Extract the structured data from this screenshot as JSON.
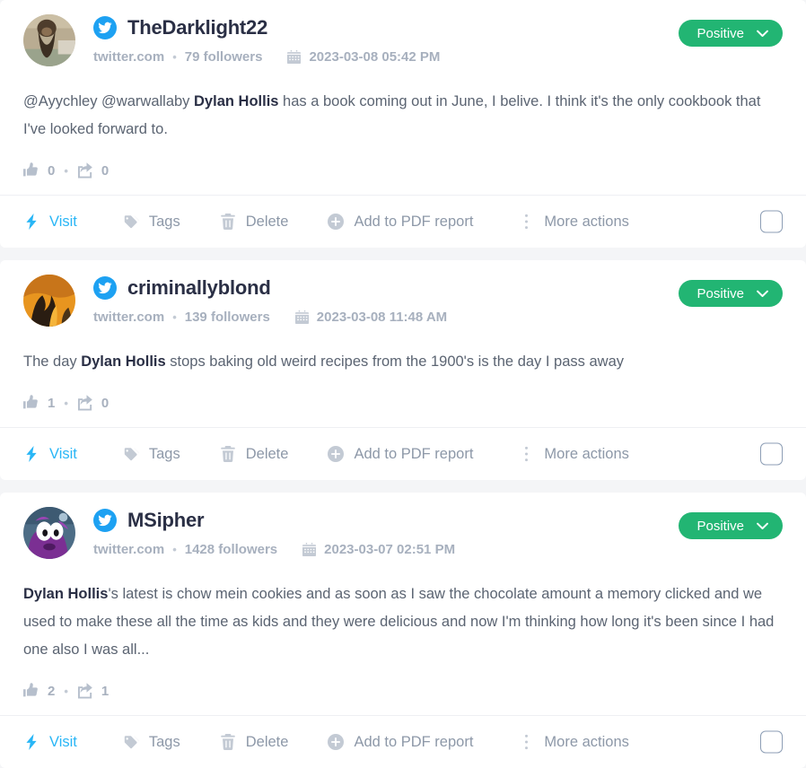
{
  "theme": {
    "page_background": "#f4f5f7",
    "card_background": "#ffffff",
    "accent_blue": "#29b6f6",
    "twitter_blue": "#1da1f2",
    "positive_green": "#22b573",
    "muted_text": "#a7b0be",
    "body_text": "#5b6472",
    "title_text": "#2a2f45"
  },
  "actions": {
    "visit": "Visit",
    "tags": "Tags",
    "delete": "Delete",
    "add_to_pdf": "Add to PDF report",
    "more": "More actions",
    "icons": {
      "visit": "lightning-bolt-icon",
      "tags": "tag-icon",
      "delete": "trash-icon",
      "add_to_pdf": "plus-circle-icon",
      "more": "vertical-dots-icon",
      "select": "checkbox-icon"
    }
  },
  "posts": [
    {
      "username": "TheDarklight22",
      "source": "twitter.com",
      "followers": "79 followers",
      "date": "2023-03-08 05:42 PM",
      "sentiment": "Positive",
      "avatar": "bearded-man-photo",
      "network_icon": "twitter-icon",
      "text_parts": [
        {
          "text": "@Ayychley @warwallaby ",
          "bold": false
        },
        {
          "text": "Dylan Hollis",
          "bold": true
        },
        {
          "text": " has a book coming out in June, I belive. I think it's the only cookbook that I've looked forward to.",
          "bold": false
        }
      ],
      "likes": "0",
      "shares": "0"
    },
    {
      "username": "criminallyblond",
      "source": "twitter.com",
      "followers": "139 followers",
      "date": "2023-03-08 11:48 AM",
      "sentiment": "Positive",
      "avatar": "orange-flame-photo",
      "network_icon": "twitter-icon",
      "text_parts": [
        {
          "text": "The day ",
          "bold": false
        },
        {
          "text": "Dylan Hollis",
          "bold": true
        },
        {
          "text": " stops baking old weird recipes from the 1900's is the day I pass away",
          "bold": false
        }
      ],
      "likes": "1",
      "shares": "0"
    },
    {
      "username": "MSipher",
      "source": "twitter.com",
      "followers": "1428 followers",
      "date": "2023-03-07 02:51 PM",
      "sentiment": "Positive",
      "avatar": "purple-cartoon-photo",
      "network_icon": "twitter-icon",
      "text_parts": [
        {
          "text": "Dylan Hollis",
          "bold": true
        },
        {
          "text": "'s latest is chow mein cookies and as soon as I saw the chocolate amount a memory clicked and we used to make these all the time as kids and they were delicious and now I'm thinking how long it's been since I had one also I was all...",
          "bold": false
        }
      ],
      "likes": "2",
      "shares": "1"
    }
  ]
}
